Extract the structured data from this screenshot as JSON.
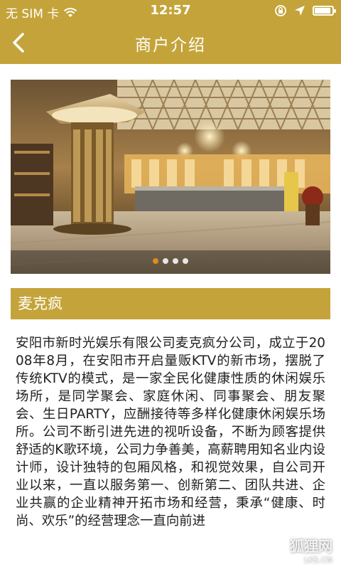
{
  "status_bar": {
    "carrier": "无 SIM 卡",
    "time": "12:57",
    "icons": [
      "wifi-icon",
      "rotation-lock-icon",
      "location-arrow-icon",
      "battery-icon"
    ]
  },
  "nav": {
    "title": "商户介绍",
    "back_icon": "chevron-left-icon"
  },
  "carousel": {
    "slide_count": 4,
    "active_index": 0,
    "image_description_icon": "banner-photo"
  },
  "merchant": {
    "name": "麦克疯",
    "description": "安阳市新时光娱乐有限公司麦克疯分公司，成立于2008年8月，在安阳市开启量贩KTV的新市场，摆脱了传统KTV的模式，是一家全民化健康性质的休闲娱乐场所，是同学聚会、家庭休闲、同事聚会、朋友聚会、生日PARTY，应酬接待等多样化健康休闲娱乐场所。公司不断引进先进的视听设备，不断为顾客提供舒适的K歌环境，公司力争善美，高薪聘用知名业内设计师，设计独特的包厢风格，和视觉效果，自公司开业以来，一直以服务第一、创新第二、团队共进、企业共赢的企业精神开拓市场和经营，秉承“健康、时尚、欢乐”的经营理念一直向前进"
  },
  "watermark": {
    "text": "狐狸网",
    "url": "LKS.CN"
  },
  "colors": {
    "accent": "#c4a43a",
    "dot_active": "#e08a1e",
    "dot_inactive": "#e6e6e6"
  }
}
